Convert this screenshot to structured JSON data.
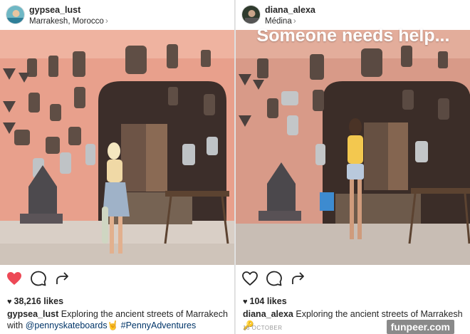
{
  "left_post": {
    "username": "gypsea_lust",
    "location": "Marrakesh, Morocco",
    "likes": "38,216 likes",
    "caption_user": "gypsea_lust",
    "caption_text": "Exploring the ancient streets of Marrakech with",
    "mention": "@pennyskateboards",
    "emoji": "🤘",
    "hashtag": "#PennyAdventures",
    "liked": true,
    "colors": {
      "heart": "#ed4956",
      "wall": "#e9a494",
      "skirt": "#9fb2c8",
      "top": "#f0d9a6"
    }
  },
  "right_post": {
    "username": "diana_alexa",
    "location": "Médina",
    "overlay_text": "Someone needs help...",
    "likes": "104 likes",
    "caption_user": "diana_alexa",
    "caption_text": "Exploring the ancient streets of Marrakesh",
    "emoji": "🔑",
    "date": "16 OCTOBER",
    "liked": false,
    "colors": {
      "wall": "#d89a88",
      "shorts": "#b9c9dc",
      "top": "#f3c84f"
    }
  },
  "icons": {
    "like": "heart-icon",
    "comment": "comment-icon",
    "share": "share-icon",
    "location_chevron": "chevron-right-icon"
  },
  "watermark": "funpeer.com"
}
